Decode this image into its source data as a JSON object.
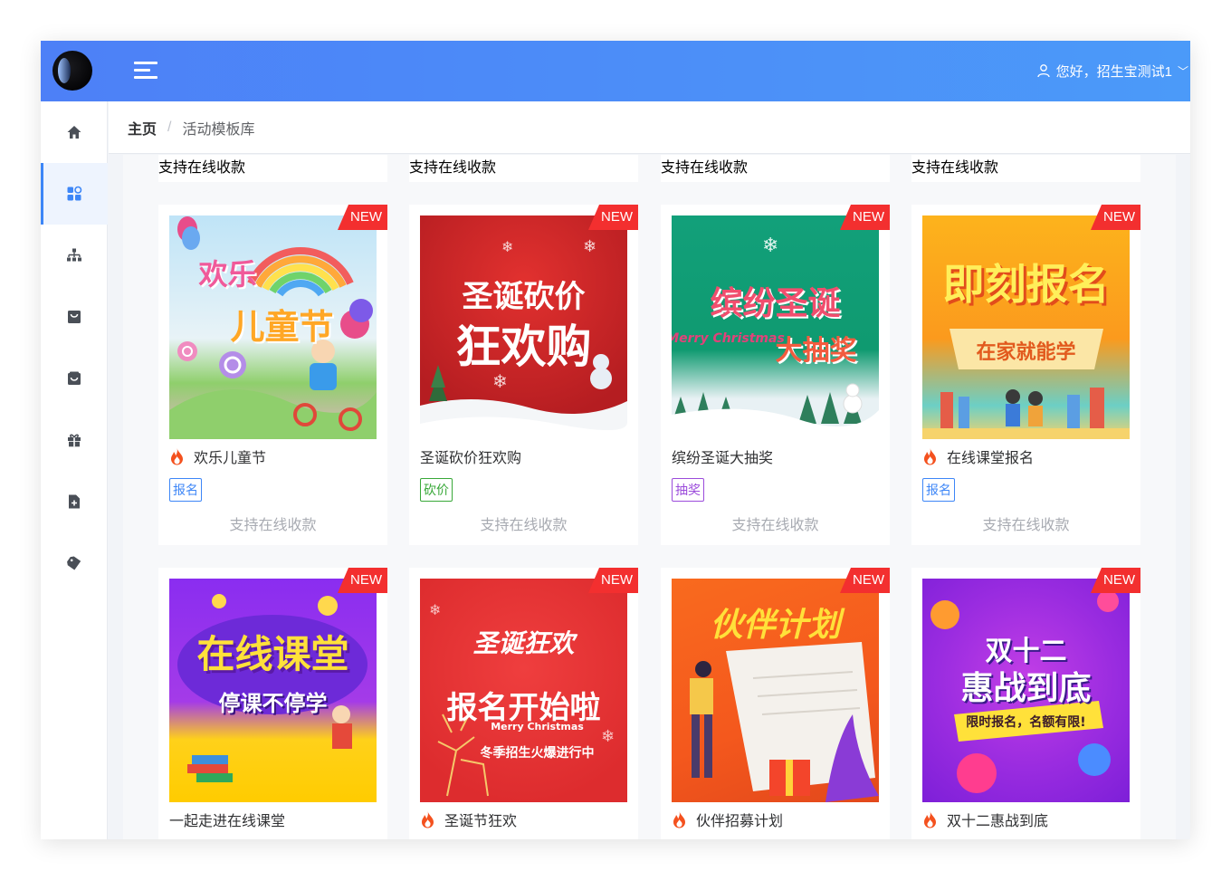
{
  "header": {
    "user_greeting": "您好，招生宝测试1",
    "chevron": "﹀"
  },
  "breadcrumb": {
    "home": "主页",
    "separator": "/",
    "current": "活动模板库"
  },
  "sidebar": {
    "items": [
      {
        "icon": "home-icon",
        "active": false
      },
      {
        "icon": "dashboard-icon",
        "active": true
      },
      {
        "icon": "org-chart-icon",
        "active": false
      },
      {
        "icon": "shopping-bag-icon",
        "active": false
      },
      {
        "icon": "orders-icon",
        "active": false
      },
      {
        "icon": "gift-icon",
        "active": false
      },
      {
        "icon": "add-document-icon",
        "active": false
      },
      {
        "icon": "tag-icon",
        "active": false
      }
    ]
  },
  "colors": {
    "accent": "#3d86f7",
    "badge": "#f32f2f",
    "tag_blue": "#3d86f7",
    "tag_green": "#38a838",
    "tag_purple": "#9b4bdb"
  },
  "common": {
    "new_badge": "NEW",
    "pay_text": "支持在线收款"
  },
  "templates": [
    {
      "title": "欢乐儿童节",
      "hot": true,
      "tag": "报名",
      "tag_color": "blue",
      "poster": [
        "欢乐",
        "儿童节"
      ]
    },
    {
      "title": "圣诞砍价狂欢购",
      "hot": false,
      "tag": "砍价",
      "tag_color": "green",
      "poster": [
        "圣诞砍价",
        "狂欢购"
      ]
    },
    {
      "title": "缤纷圣诞大抽奖",
      "hot": false,
      "tag": "抽奖",
      "tag_color": "purple",
      "poster": [
        "缤纷圣诞",
        "Merry Christmas",
        "大抽奖"
      ]
    },
    {
      "title": "在线课堂报名",
      "hot": true,
      "tag": "报名",
      "tag_color": "blue",
      "poster": [
        "即刻报名",
        "在家就能学"
      ]
    },
    {
      "title": "一起走进在线课堂",
      "hot": false,
      "poster": [
        "在线课堂",
        "停课不停学"
      ]
    },
    {
      "title": "圣诞节狂欢",
      "hot": true,
      "poster": [
        "圣诞狂欢",
        "报名开始啦",
        "Merry Christmas",
        "冬季招生火爆进行中"
      ]
    },
    {
      "title": "伙伴招募计划",
      "hot": true,
      "poster": [
        "伙伴计划"
      ]
    },
    {
      "title": "双十二惠战到底",
      "hot": true,
      "poster": [
        "双十二",
        "惠战到底",
        "限时报名，名额有限!"
      ]
    }
  ]
}
